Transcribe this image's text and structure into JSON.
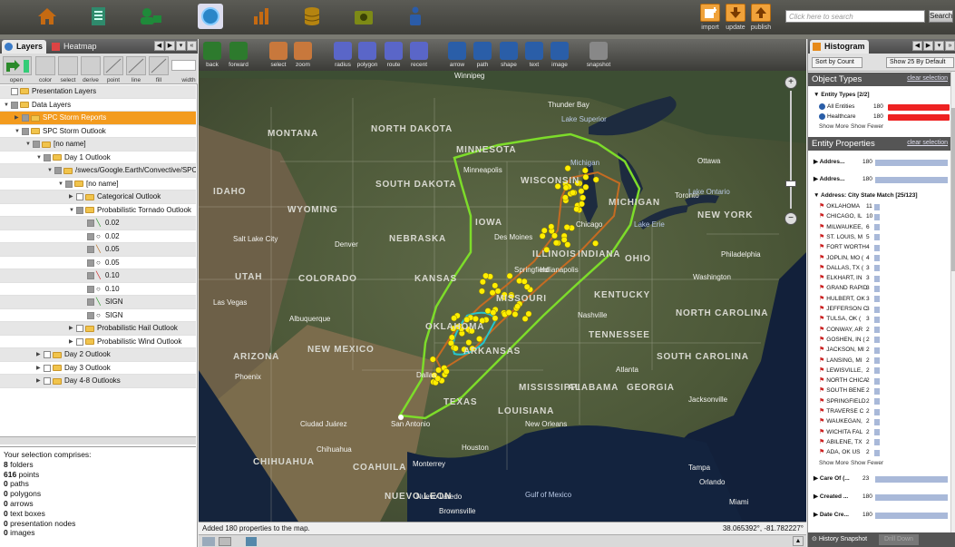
{
  "app": {
    "nav_icons": [
      "home-icon",
      "document-icon",
      "users-icon",
      "globe-icon",
      "chart-icon",
      "database-icon",
      "folder-icon",
      "person-icon"
    ],
    "actions": [
      {
        "label": "import",
        "icon": "import-icon"
      },
      {
        "label": "update",
        "icon": "down-arrow-icon"
      },
      {
        "label": "publish",
        "icon": "up-arrow-icon"
      }
    ],
    "search": {
      "placeholder": "Click here to search",
      "button": "Search"
    }
  },
  "left": {
    "tabs": [
      "Layers",
      "Heatmap"
    ],
    "tools": [
      "open",
      "color",
      "select",
      "derive",
      "point",
      "line",
      "fill",
      "width"
    ],
    "tree": [
      {
        "label": "Presentation Layers",
        "level": 0,
        "tri": "",
        "chk": false
      },
      {
        "label": "Data Layers",
        "level": 0,
        "tri": "▼",
        "chk": true
      },
      {
        "label": "SPC Storm Reports",
        "level": 1,
        "tri": "▶",
        "chk": true,
        "sel": true
      },
      {
        "label": "SPC Storm Outlook",
        "level": 1,
        "tri": "▼",
        "chk": true
      },
      {
        "label": "[no name]",
        "level": 2,
        "tri": "▼",
        "chk": true
      },
      {
        "label": "Day 1 Outlook",
        "level": 3,
        "tri": "▼",
        "chk": true
      },
      {
        "label": "/swecs/Google.Earth/Convective/SPC",
        "level": 4,
        "tri": "▼",
        "chk": true
      },
      {
        "label": "[no name]",
        "level": 5,
        "tri": "▼",
        "chk": true
      },
      {
        "label": "Categorical Outlook",
        "level": 6,
        "tri": "▶",
        "chk": false
      },
      {
        "label": "Probabilistic Tornado Outlook",
        "level": 6,
        "tri": "▼",
        "chk": true
      },
      {
        "label": "0.02",
        "level": 7,
        "tri": "",
        "chk": true,
        "sym": "╲",
        "symc": "#2a9a2a"
      },
      {
        "label": "0.02",
        "level": 7,
        "tri": "",
        "chk": true,
        "sym": "○"
      },
      {
        "label": "0.05",
        "level": 7,
        "tri": "",
        "chk": true,
        "sym": "╲",
        "symc": "#b66b1e"
      },
      {
        "label": "0.05",
        "level": 7,
        "tri": "",
        "chk": true,
        "sym": "○"
      },
      {
        "label": "0.10",
        "level": 7,
        "tri": "",
        "chk": true,
        "sym": "╲",
        "symc": "#c22"
      },
      {
        "label": "0.10",
        "level": 7,
        "tri": "",
        "chk": true,
        "sym": "○"
      },
      {
        "label": "SIGN",
        "level": 7,
        "tri": "",
        "chk": true,
        "sym": "╲",
        "symc": "#2a9a2a"
      },
      {
        "label": "SIGN",
        "level": 7,
        "tri": "",
        "chk": true,
        "sym": "○"
      },
      {
        "label": "Probabilistic Hail Outlook",
        "level": 6,
        "tri": "▶",
        "chk": false
      },
      {
        "label": "Probabilistic Wind Outlook",
        "level": 6,
        "tri": "▶",
        "chk": false
      },
      {
        "label": "Day 2 Outlook",
        "level": 3,
        "tri": "▶",
        "chk": false
      },
      {
        "label": "Day 3 Outlook",
        "level": 3,
        "tri": "▶",
        "chk": false
      },
      {
        "label": "Day 4-8 Outlooks",
        "level": 3,
        "tri": "▶",
        "chk": false
      }
    ],
    "summary_title": "Your selection comprises:",
    "summary": [
      {
        "n": "8",
        "label": "folders"
      },
      {
        "n": "616",
        "label": "points"
      },
      {
        "n": "0",
        "label": "paths"
      },
      {
        "n": "0",
        "label": "polygons"
      },
      {
        "n": "0",
        "label": "arrows"
      },
      {
        "n": "0",
        "label": "text boxes"
      },
      {
        "n": "0",
        "label": "presentation nodes"
      },
      {
        "n": "0",
        "label": "images"
      }
    ]
  },
  "map": {
    "tools": [
      "back",
      "forward",
      "select",
      "zoom",
      "radius",
      "polygon",
      "route",
      "recent",
      "arrow",
      "path",
      "shape",
      "text",
      "image",
      "snapshot"
    ],
    "labels": [
      {
        "t": "Winnipeg",
        "c": "city"
      },
      {
        "t": "Thunder Bay",
        "c": "city"
      },
      {
        "t": "Lake Superior",
        "c": "water"
      },
      {
        "t": "MONTANA",
        "c": "state"
      },
      {
        "t": "NORTH DAKOTA",
        "c": "state"
      },
      {
        "t": "MINNESOTA",
        "c": "state"
      },
      {
        "t": "Minneapolis",
        "c": "city"
      },
      {
        "t": "WISCONSIN",
        "c": "state"
      },
      {
        "t": "Michigan",
        "c": "water"
      },
      {
        "t": "SOUTH DAKOTA",
        "c": "state"
      },
      {
        "t": "IDAHO",
        "c": "state"
      },
      {
        "t": "WYOMING",
        "c": "state"
      },
      {
        "t": "IOWA",
        "c": "state"
      },
      {
        "t": "NEBRASKA",
        "c": "state"
      },
      {
        "t": "Des Moines",
        "c": "city"
      },
      {
        "t": "Chicago",
        "c": "city"
      },
      {
        "t": "MICHIGAN",
        "c": "state"
      },
      {
        "t": "Ottawa",
        "c": "city"
      },
      {
        "t": "Toronto",
        "c": "city"
      },
      {
        "t": "Lake Ontario",
        "c": "water"
      },
      {
        "t": "Lake Erie",
        "c": "water"
      },
      {
        "t": "NEW YORK",
        "c": "state"
      },
      {
        "t": "Salt Lake City",
        "c": "city"
      },
      {
        "t": "Denver",
        "c": "city"
      },
      {
        "t": "ILLINOIS",
        "c": "state"
      },
      {
        "t": "INDIANA",
        "c": "state"
      },
      {
        "t": "OHIO",
        "c": "state"
      },
      {
        "t": "Indianapolis",
        "c": "city"
      },
      {
        "t": "Springfield",
        "c": "city"
      },
      {
        "t": "COLORADO",
        "c": "state"
      },
      {
        "t": "KANSAS",
        "c": "state"
      },
      {
        "t": "UTAH",
        "c": "state"
      },
      {
        "t": "MISSOURI",
        "c": "state"
      },
      {
        "t": "KENTUCKY",
        "c": "state"
      },
      {
        "t": "Philadelphia",
        "c": "city"
      },
      {
        "t": "Washington",
        "c": "city"
      },
      {
        "t": "Las Vegas",
        "c": "city"
      },
      {
        "t": "Albuquerque",
        "c": "city"
      },
      {
        "t": "OKLAHOMA",
        "c": "state"
      },
      {
        "t": "TENNESSEE",
        "c": "state"
      },
      {
        "t": "Nashville",
        "c": "city"
      },
      {
        "t": "NORTH CAROLINA",
        "c": "state"
      },
      {
        "t": "ARIZONA",
        "c": "state"
      },
      {
        "t": "NEW MEXICO",
        "c": "state"
      },
      {
        "t": "ARKANSAS",
        "c": "state"
      },
      {
        "t": "Phoenix",
        "c": "city"
      },
      {
        "t": "Atlanta",
        "c": "city"
      },
      {
        "t": "SOUTH CAROLINA",
        "c": "state"
      },
      {
        "t": "MISSISSIPPI",
        "c": "state"
      },
      {
        "t": "ALABAMA",
        "c": "state"
      },
      {
        "t": "GEORGIA",
        "c": "state"
      },
      {
        "t": "Dallas",
        "c": "city"
      },
      {
        "t": "TEXAS",
        "c": "state"
      },
      {
        "t": "LOUISIANA",
        "c": "state"
      },
      {
        "t": "San Antonio",
        "c": "city"
      },
      {
        "t": "Houston",
        "c": "city"
      },
      {
        "t": "New Orleans",
        "c": "city"
      },
      {
        "t": "Jacksonville",
        "c": "city"
      },
      {
        "t": "Ciudad Juárez",
        "c": "city"
      },
      {
        "t": "Chihuahua",
        "c": "city"
      },
      {
        "t": "CHIHUAHUA",
        "c": "state"
      },
      {
        "t": "COAHUILA",
        "c": "state"
      },
      {
        "t": "Monterrey",
        "c": "city"
      },
      {
        "t": "NUEVO LEON",
        "c": "state"
      },
      {
        "t": "Gulf of Mexico",
        "c": "water"
      },
      {
        "t": "Nuevo Laredo",
        "c": "city"
      },
      {
        "t": "Brownsville",
        "c": "city"
      },
      {
        "t": "Tampa",
        "c": "city"
      },
      {
        "t": "Miami",
        "c": "city"
      },
      {
        "t": "Orlando",
        "c": "city"
      }
    ],
    "status_text": "Added 180 properties to the map.",
    "coords": "38.065392°, -81.782227°"
  },
  "right": {
    "tabs": [
      "Histogram"
    ],
    "sort": "Sort by Count",
    "show": "Show 25 By Default",
    "object_types_title": "Object Types",
    "clear": "clear selection",
    "entity_types_label": "Entity Types [2/2]",
    "entity_types": [
      {
        "label": "All Entities",
        "n": "180",
        "icon": "globe-icon"
      },
      {
        "label": "Healthcare",
        "n": "180",
        "icon": "hospital-icon"
      }
    ],
    "show_more": "Show More",
    "show_fewer": "Show Fewer",
    "entity_props_title": "Entity Properties",
    "props_top": [
      {
        "label": "Addres...",
        "n": "180"
      },
      {
        "label": "Addres...",
        "n": "180"
      }
    ],
    "match_label": "Address: City State Match [25/123]",
    "cities": [
      {
        "label": "OKLAHOMA",
        "n": "11"
      },
      {
        "label": "CHICAGO, IL",
        "n": "10"
      },
      {
        "label": "MILWAUKEE,",
        "n": "6"
      },
      {
        "label": "ST. LOUIS, M",
        "n": "5"
      },
      {
        "label": "FORT WORTH",
        "n": "4"
      },
      {
        "label": "JOPLIN, MO (",
        "n": "4"
      },
      {
        "label": "DALLAS, TX (",
        "n": "3"
      },
      {
        "label": "ELKHART, IN",
        "n": "3"
      },
      {
        "label": "GRAND RAPID",
        "n": "3"
      },
      {
        "label": "HULBERT, OK",
        "n": "3"
      },
      {
        "label": "JEFFERSON C",
        "n": "3"
      },
      {
        "label": "TULSA, OK (",
        "n": "3"
      },
      {
        "label": "CONWAY, AR",
        "n": "2"
      },
      {
        "label": "GOSHEN, IN (",
        "n": "2"
      },
      {
        "label": "JACKSON, MI",
        "n": "2"
      },
      {
        "label": "LANSING, MI",
        "n": "2"
      },
      {
        "label": "LEWISVILLE,",
        "n": "2"
      },
      {
        "label": "NORTH CHICA",
        "n": "2"
      },
      {
        "label": "SOUTH BENE",
        "n": "2"
      },
      {
        "label": "SPRINGFIELD",
        "n": "2"
      },
      {
        "label": "TRAVERSE C",
        "n": "2"
      },
      {
        "label": "WAUKEGAN,",
        "n": "2"
      },
      {
        "label": "WICHITA FAL",
        "n": "2"
      },
      {
        "label": "ABILENE, TX",
        "n": "2"
      },
      {
        "label": "ADA, OK US",
        "n": "2"
      }
    ],
    "props_bottom": [
      {
        "label": "Care Of (...",
        "n": "23"
      },
      {
        "label": "Created ...",
        "n": "180"
      },
      {
        "label": "Date Cre...",
        "n": "180"
      }
    ],
    "bottom_tabs": [
      "History Snapshot",
      "Drill Down"
    ]
  }
}
